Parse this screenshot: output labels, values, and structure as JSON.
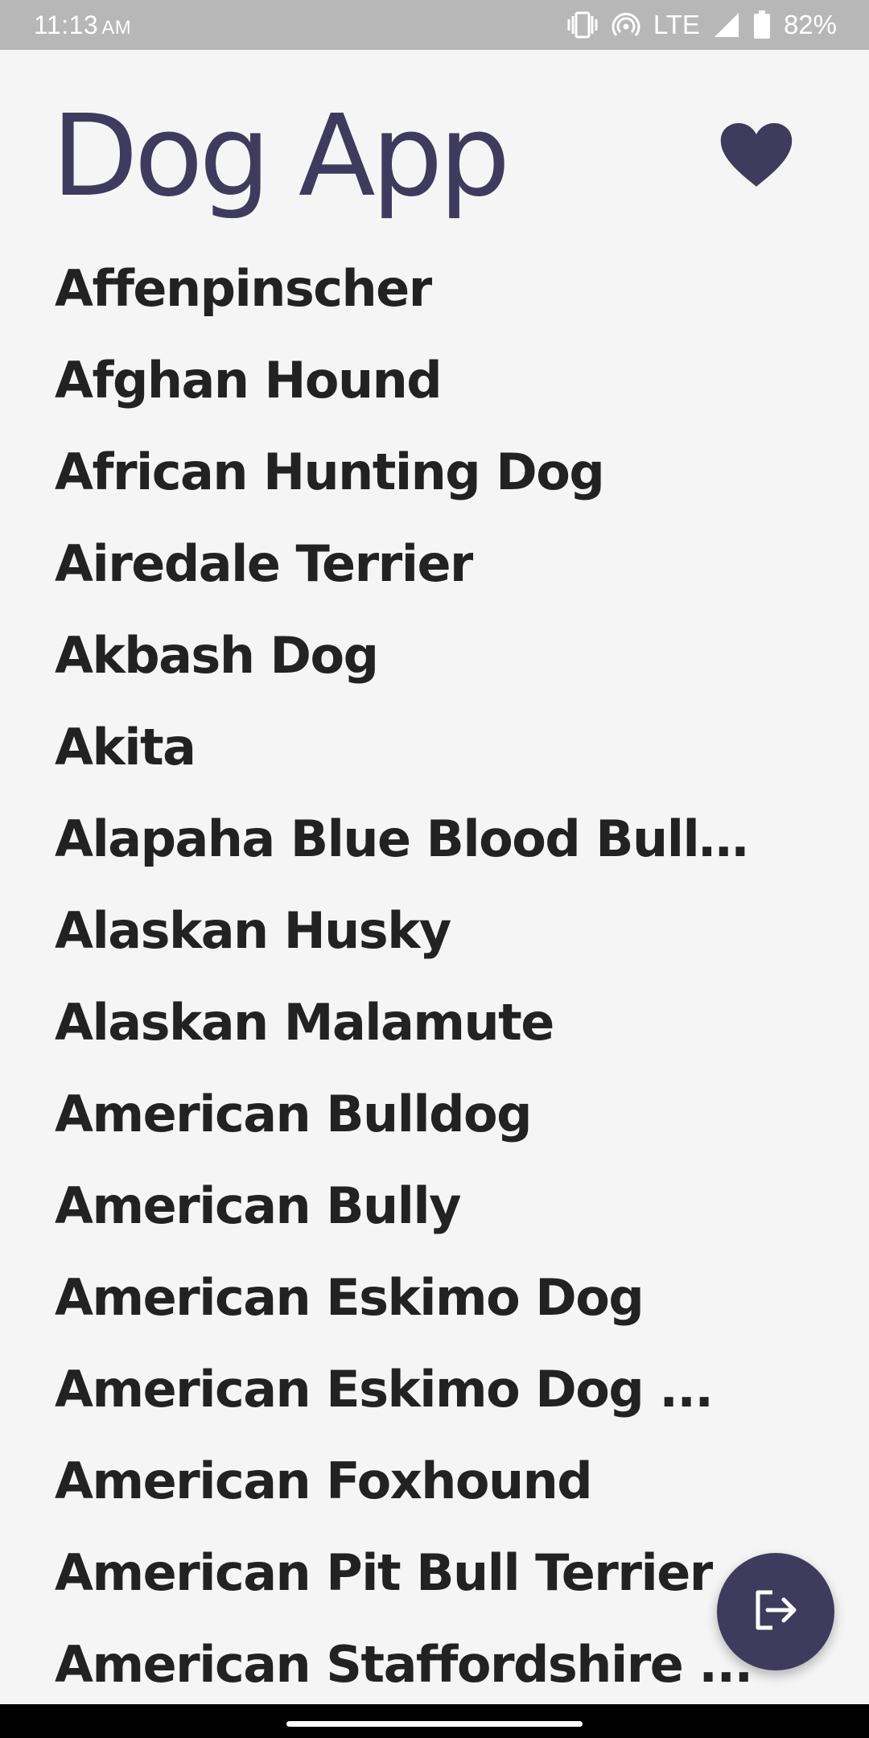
{
  "status_bar": {
    "time": "11:13",
    "ampm": "AM",
    "network": "LTE",
    "battery": "82%",
    "icons": [
      "vibrate-icon",
      "hotspot-icon",
      "signal-icon",
      "battery-icon"
    ]
  },
  "header": {
    "title": "Dog App",
    "favorites_icon": "heart-icon"
  },
  "breeds": [
    "Affenpinscher",
    "Afghan Hound",
    "African Hunting Dog",
    "Airedale Terrier",
    "Akbash Dog",
    "Akita",
    "Alapaha Blue Blood Bulldog",
    "Alaskan Husky",
    "Alaskan Malamute",
    "American Bulldog",
    "American Bully",
    "American Eskimo Dog",
    "American Eskimo Dog ...",
    "American Foxhound",
    "American Pit Bull Terrier",
    "American Staffordshire ..."
  ],
  "fab": {
    "icon": "logout-icon"
  },
  "colors": {
    "accent": "#3f3b5e",
    "background": "#f5f5f5",
    "status_bar": "#b7b7b7",
    "text": "#222222"
  }
}
